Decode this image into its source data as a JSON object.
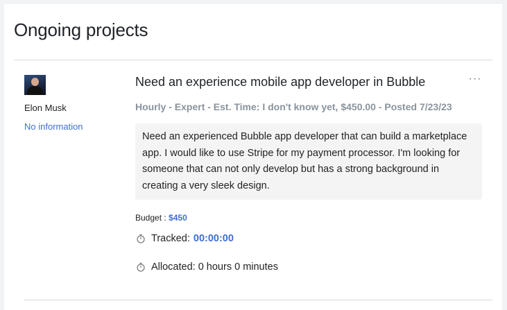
{
  "page": {
    "title": "Ongoing projects"
  },
  "author": {
    "name": "Elon Musk",
    "info_link": "No information"
  },
  "project": {
    "title": "Need an experience mobile app developer in Bubble",
    "more_label": "···",
    "meta": "Hourly - Expert - Est. Time: I don't know yet, $450.00 - Posted 7/23/23",
    "description": "Need an experienced Bubble app developer that can build a marketplace app. I would like to use Stripe for my payment processor. I'm looking for someone that can not only develop but has a strong background in creating a very sleek design.",
    "budget_label": "Budget : ",
    "budget_value": "$450",
    "tracked_label": "Tracked:",
    "tracked_value": "00:00:00",
    "allocated_text": "Allocated: 0 hours 0 minutes"
  },
  "icons": {
    "more": "more-horizontal-icon",
    "tracked": "stopwatch-icon",
    "allocated": "stopwatch-icon"
  },
  "colors": {
    "link": "#3f6fd1",
    "meta": "#8a939c",
    "description_bg": "#f4f4f5",
    "page_bg": "#f1f3f4"
  }
}
